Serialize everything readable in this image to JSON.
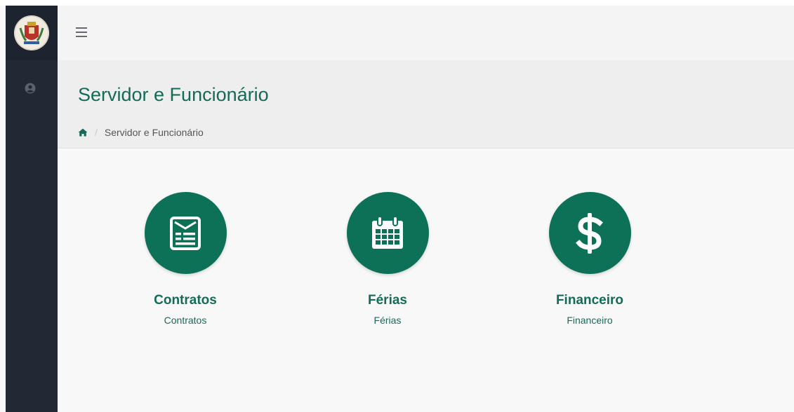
{
  "colors": {
    "accent": "#0d7158",
    "title": "#156b58",
    "sidebar": "#222834"
  },
  "sidebar": {
    "logo_icon": "city-crest-icon",
    "user_icon": "user-circle-icon"
  },
  "navbar": {
    "menu_icon": "hamburger-icon"
  },
  "header": {
    "title": "Servidor e Funcionário",
    "breadcrumb": {
      "home_icon": "home-icon",
      "current": "Servidor e Funcionário"
    }
  },
  "tiles": [
    {
      "icon": "contract-document-icon",
      "title": "Contratos",
      "subtitle": "Contratos"
    },
    {
      "icon": "calendar-icon",
      "title": "Férias",
      "subtitle": "Férias"
    },
    {
      "icon": "dollar-sign-icon",
      "title": "Financeiro",
      "subtitle": "Financeiro"
    }
  ]
}
